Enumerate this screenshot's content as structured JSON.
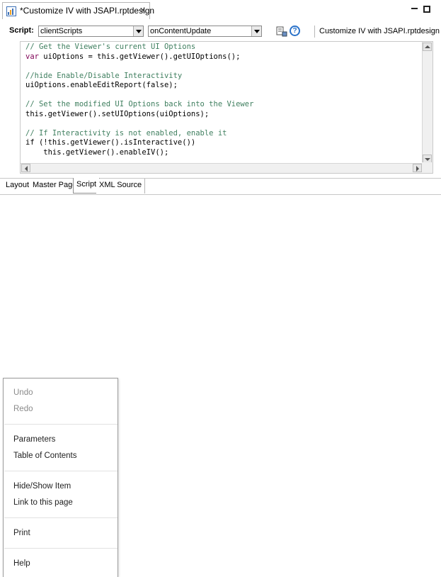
{
  "editor": {
    "tab_title": "*Customize IV with JSAPI.rptdesign",
    "script_label": "Script:",
    "script_combo": "clientScripts",
    "event_combo": "onContentUpdate",
    "method_name": "Customize IV with JSAPI.rptdesign",
    "code_lines": [
      "// Get the Viewer's current UI Options",
      "var uiOptions = this.getViewer().getUIOptions();",
      "",
      "//hide Enable/Disable Interactivity",
      "uiOptions.enableEditReport(false);",
      "",
      "// Set the modified UI Options back into the Viewer",
      "this.getViewer().setUIOptions(uiOptions);",
      "",
      "// If Interactivity is not enabled, enable it",
      "if (!this.getViewer().isInteractive())",
      "    this.getViewer().enableIV();"
    ],
    "bottom_tabs": [
      "Layout",
      "Master Page",
      "Script",
      "XML Source"
    ],
    "active_tab": "Script"
  },
  "context_menu": {
    "undo": "Undo",
    "redo": "Redo",
    "parameters": "Parameters",
    "table_of_contents": "Table of Contents",
    "hide_show_item": "Hide/Show Item",
    "link_to_page": "Link to this page",
    "print": "Print",
    "help": "Help"
  },
  "icons": {
    "tab": "report-design-icon",
    "close": "close-icon",
    "minimize": "minimize-icon",
    "maximize": "maximize-icon",
    "palette": "palette-icon",
    "help": "help-icon"
  },
  "colors": {
    "comment": "#3f7f5f",
    "keyword": "#7f0055",
    "help_blue": "#2a72c9"
  }
}
